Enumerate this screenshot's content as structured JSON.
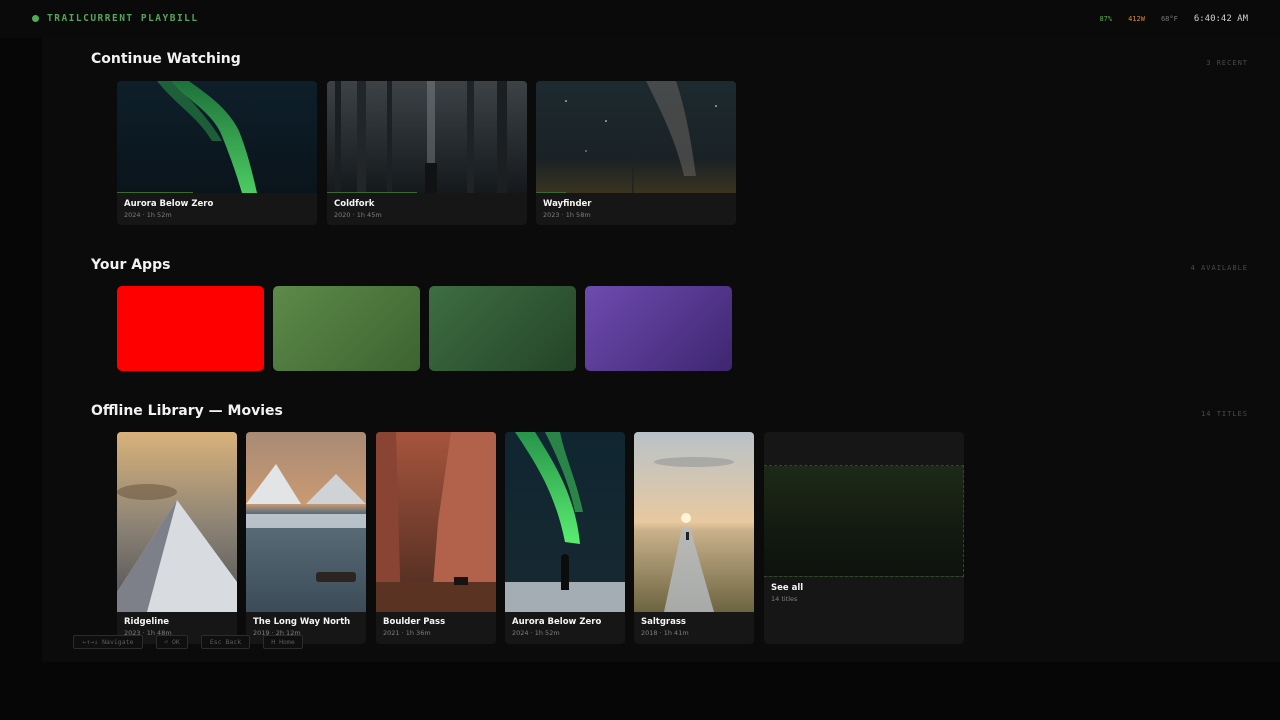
{
  "header": {
    "brand": "TRAILCURRENT PLAYBILL",
    "battery": "87%",
    "power": "412W",
    "temperature": "68°F",
    "time": "6:40:42 AM"
  },
  "continue_watching": {
    "title": "Continue Watching",
    "meta": "3 RECENT",
    "items": [
      {
        "title": "Aurora Below Zero",
        "meta": "2024 · 1h 52m",
        "progress": 0.38
      },
      {
        "title": "Coldfork",
        "meta": "2020 · 1h 45m",
        "progress": 0.45
      },
      {
        "title": "Wayfinder",
        "meta": "2023 · 1h 58m",
        "progress": 0.15
      }
    ]
  },
  "apps": {
    "title": "Your Apps",
    "meta": "4 AVAILABLE",
    "colors": [
      "#ff0000",
      "#507a3f",
      "#36613a",
      "#5e3b94"
    ]
  },
  "library": {
    "title": "Offline Library — Movies",
    "meta": "14 TITLES",
    "items": [
      {
        "title": "Ridgeline",
        "meta": "2023 · 1h 48m"
      },
      {
        "title": "The Long Way North",
        "meta": "2019 · 2h 12m"
      },
      {
        "title": "Boulder Pass",
        "meta": "2021 · 1h 36m"
      },
      {
        "title": "Aurora Below Zero",
        "meta": "2024 · 1h 52m"
      },
      {
        "title": "Saltgrass",
        "meta": "2018 · 1h 41m"
      }
    ],
    "see_all": {
      "title": "See all",
      "meta": "14 titles"
    }
  },
  "hints": [
    "←↑→↓ Navigate",
    "⏎ OK",
    "Esc Back",
    "H Home"
  ]
}
